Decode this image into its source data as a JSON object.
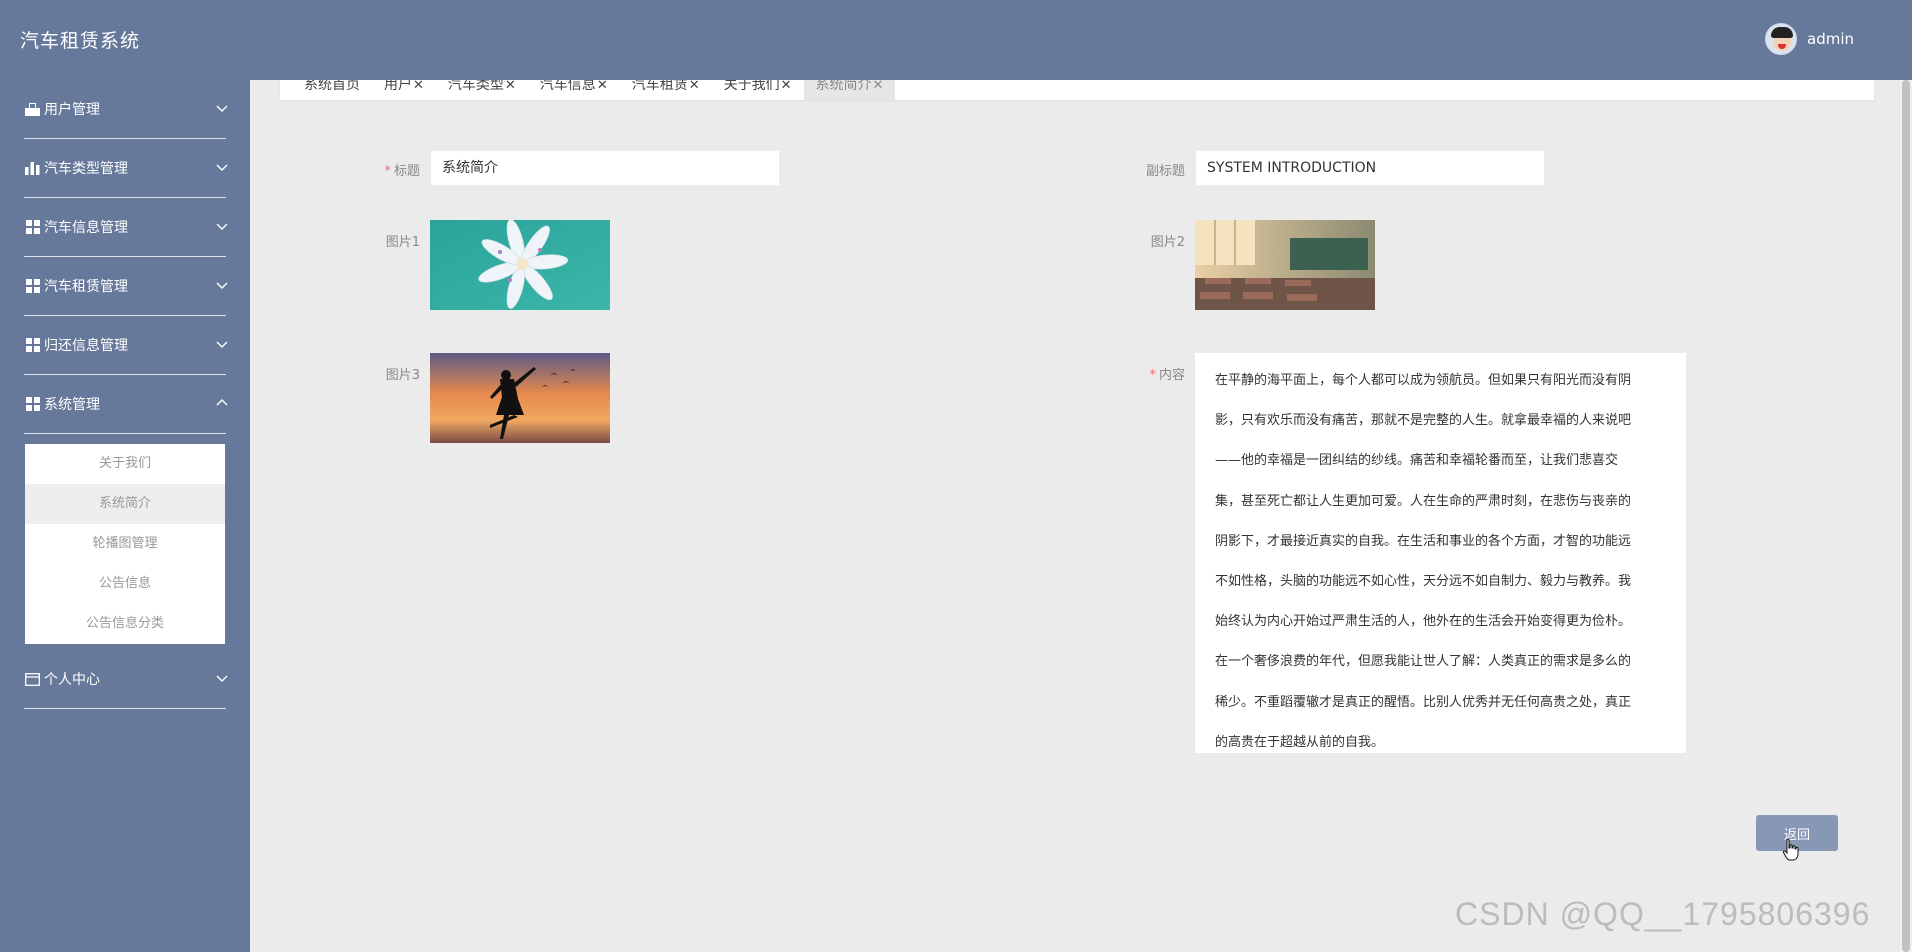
{
  "header": {
    "app_title": "汽车租赁系统",
    "username": "admin"
  },
  "sidebar": {
    "items": [
      {
        "label": "用户管理",
        "icon": "user-icon",
        "expanded": false
      },
      {
        "label": "汽车类型管理",
        "icon": "bar-chart-icon",
        "expanded": false
      },
      {
        "label": "汽车信息管理",
        "icon": "grid-icon",
        "expanded": false
      },
      {
        "label": "汽车租赁管理",
        "icon": "grid-icon",
        "expanded": false
      },
      {
        "label": "归还信息管理",
        "icon": "grid-icon",
        "expanded": false
      },
      {
        "label": "系统管理",
        "icon": "grid-icon",
        "expanded": true
      },
      {
        "label": "个人中心",
        "icon": "card-icon",
        "expanded": false
      }
    ],
    "submenu": [
      "关于我们",
      "系统简介",
      "轮播图管理",
      "公告信息",
      "公告信息分类"
    ],
    "submenu_active": "系统简介"
  },
  "tabs": [
    {
      "label": "系统首页",
      "closable": false
    },
    {
      "label": "用户",
      "closable": true
    },
    {
      "label": "汽车类型",
      "closable": true
    },
    {
      "label": "汽车信息",
      "closable": true
    },
    {
      "label": "汽车租赁",
      "closable": true
    },
    {
      "label": "关于我们",
      "closable": true
    },
    {
      "label": "系统简介",
      "closable": true,
      "active": true
    }
  ],
  "form": {
    "title_label": "标题",
    "title_value": "系统简介",
    "subtitle_label": "副标题",
    "subtitle_value": "SYSTEM INTRODUCTION",
    "picture1_label": "图片1",
    "picture2_label": "图片2",
    "picture3_label": "图片3",
    "content_label": "内容",
    "content_lines": [
      "在平静的海平面上，每个人都可以成为领航员。但如果只有阳光而没有阴",
      "影，只有欢乐而没有痛苦，那就不是完整的人生。就拿最幸福的人来说吧",
      "——他的幸福是一团纠结的纱线。痛苦和幸福轮番而至，让我们悲喜交",
      "集，甚至死亡都让人生更加可爱。人在生命的严肃时刻，在悲伤与丧亲的",
      "阴影下，才最接近真实的自我。在生活和事业的各个方面，才智的功能远",
      "不如性格，头脑的功能远不如心性，天分远不如自制力、毅力与教养。我",
      "始终认为内心开始过严肃生活的人，他外在的生活会开始变得更为俭朴。",
      "在一个奢侈浪费的年代，但愿我能让世人了解：人类真正的需求是多么的",
      "稀少。不重蹈覆辙才是真正的醒悟。比别人优秀并无任何高贵之处，真正",
      "的高贵在于超越从前的自我。"
    ],
    "back_label": "返回"
  },
  "watermark": "CSDN @QQ__1795806396",
  "colors": {
    "header_bg": "#66799a",
    "sidebar_bg": "#66799a",
    "button_bg": "#8797b5",
    "required_mark": "#f56c6c"
  }
}
